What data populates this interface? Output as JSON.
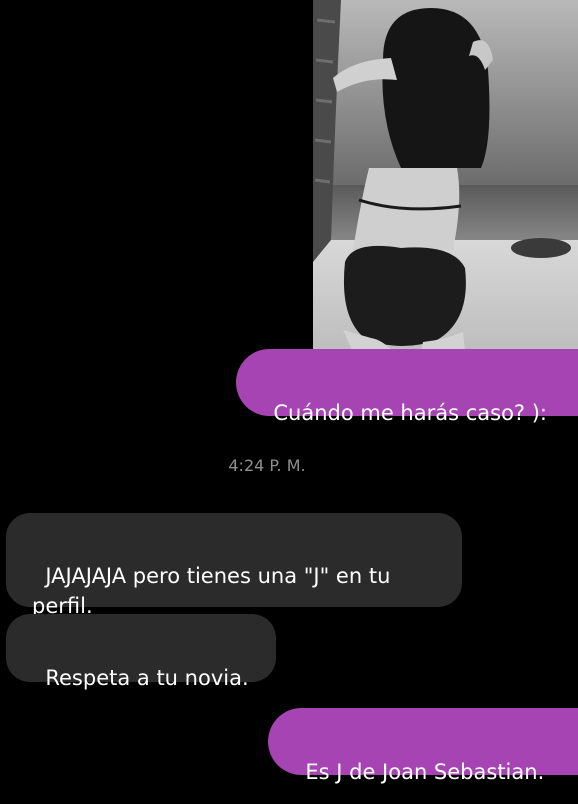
{
  "conversation": {
    "shared_photo": {
      "description": "black-and-white beach photo"
    },
    "messages": [
      {
        "direction": "sent",
        "text": "Cuándo me harás caso? ):"
      },
      {
        "direction": "received",
        "text": "JAJAJAJA pero tienes una \"J\" en tu perfil."
      },
      {
        "direction": "received",
        "text": "Respeta a tu novia."
      },
      {
        "direction": "sent",
        "text": "Es J de Joan Sebastian."
      }
    ],
    "timestamp": "4:24 P. M."
  },
  "colors": {
    "background": "#000000",
    "sent_bubble": "#a644b3",
    "received_bubble": "#2b2b2b",
    "timestamp_text": "#8f8f8f"
  }
}
